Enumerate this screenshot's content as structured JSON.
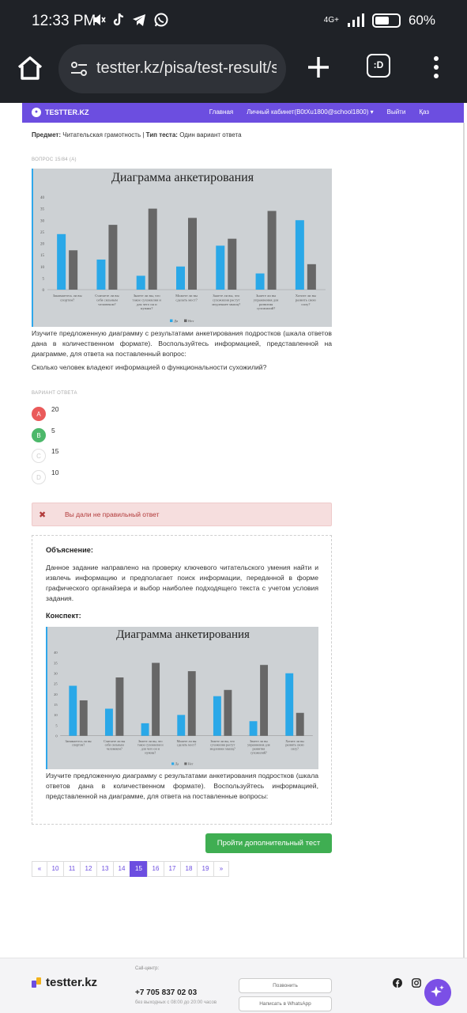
{
  "status_bar": {
    "time": "12:33 PM",
    "network": "4G+",
    "battery": "60%",
    "battery_level": 0.6
  },
  "browser": {
    "url": "testter.kz/pisa/test-result/s",
    "tabs_label": ":D"
  },
  "nav": {
    "brand": "TESTTER.KZ",
    "links": [
      "Главная",
      "Личный кабинет(B0tXu1800@school1800) ▾",
      "Выйти",
      "Қаз"
    ]
  },
  "subject": {
    "label": "Предмет:",
    "value": "Читательская грамотность",
    "type_label": "Тип теста:",
    "type_value": "Один вариант ответа"
  },
  "question_number": "ВОПРОС 15/84 (А)",
  "chart_data": {
    "type": "bar",
    "title": "Диаграмма анкетирования",
    "categories": [
      "Занимаетесь ли вы спортом?",
      "Считаете ли вы себя сильным человеком?",
      "Знаете ли вы, что такое сухожилия и для чего он и нужны?",
      "Можете ли вы сделать мост?",
      "Знаете ли вы, что сухожилия растут медленнее мышц?",
      "Знаете ли вы упражнения для развития сухожилий?",
      "Хотите ли вы развить свою силу?"
    ],
    "category_lines": [
      [
        "Занимаетесь ли вы",
        "спортом?"
      ],
      [
        "Считаете ли вы",
        "себя сильным",
        "человеком?"
      ],
      [
        "Знаете ли вы, что",
        "такое сухожилия и",
        "для чего он и",
        "нужны?"
      ],
      [
        "Можете ли вы",
        "сделать мост?"
      ],
      [
        "Знаете ли вы, что",
        "сухожилия растут",
        "медленнее мышц?"
      ],
      [
        "Знаете ли вы",
        "упражнения для",
        "развития",
        "сухожилий?"
      ],
      [
        "Хотите ли вы",
        "развить свою",
        "силу?"
      ]
    ],
    "series": [
      {
        "name": "Да",
        "color": "#2aa8e8",
        "values": [
          24,
          13,
          6,
          10,
          19,
          7,
          30
        ]
      },
      {
        "name": "Нет",
        "color": "#676767",
        "values": [
          17,
          28,
          35,
          31,
          22,
          34,
          11
        ]
      }
    ],
    "ylim": [
      0,
      40
    ],
    "yticks": [
      0,
      5,
      10,
      15,
      20,
      25,
      30,
      35,
      40
    ],
    "grid": false,
    "legend": "bottom"
  },
  "instruction": "Изучите предложенную диаграмму с результатами анкетирования подростков (шкала ответов дана в количественном формате). Воспользуйтесь информацией, представленной на диаграмме, для ответа на поставленный вопрос:",
  "question": "Сколько человек владеют информацией о функциональности сухожилий?",
  "answers_label": "ВАРИАНТ ОТВЕТА",
  "answers": [
    {
      "letter": "A",
      "text": "20",
      "state": "wrong",
      "color": "#ea5a5a"
    },
    {
      "letter": "B",
      "text": "5",
      "state": "correct",
      "color": "#4cb86a"
    },
    {
      "letter": "C",
      "text": "15",
      "state": "none",
      "color": "#ffffff"
    },
    {
      "letter": "D",
      "text": "10",
      "state": "none",
      "color": "#ffffff"
    }
  ],
  "alert": {
    "icon": "✖",
    "text": "Вы дали не правильный ответ"
  },
  "explanation": {
    "heading": "Объяснение:",
    "text": "Данное задание направлено на проверку ключевого читательского умения найти и извлечь информацию и предполагает поиск информации, переданной в форме графического органайзера и выбор наиболее подходящего текста с учетом условия задания.",
    "summary_heading": "Конспект:",
    "summary_text": "Изучите предложенную диаграмму с результатами анкетирования подростков (шкала ответов дана в количественном формате). Воспользуйтесь информацией, представленной на диаграмме, для ответа на поставленные вопросы:"
  },
  "next_button": "Пройти дополнительный тест",
  "pagination": {
    "prev": "«",
    "pages": [
      "10",
      "11",
      "12",
      "13",
      "14",
      "15",
      "16",
      "17",
      "18",
      "19"
    ],
    "current": "15",
    "next": "»"
  },
  "footer": {
    "brand": "testter.kz",
    "call_label": "Call-центр:",
    "phone": "+7 705 837 02 03",
    "hours": "без выходных с 08:00 до 20:00 часов",
    "call_button": "Позвонить",
    "whatsapp_button": "Написать в WhatsApp"
  },
  "colors": {
    "accent": "#6c4ee0",
    "success": "#3fae52",
    "danger": "#b23b3b"
  }
}
